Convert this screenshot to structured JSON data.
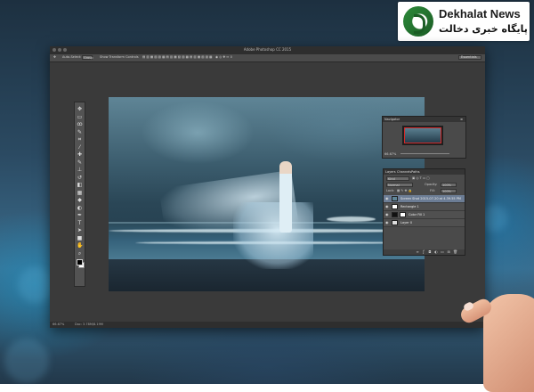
{
  "watermark": {
    "title": "Dekhalat News",
    "subtitle": "پایگاه خبری دخالت"
  },
  "app": {
    "window_title": "Adobe Photoshop CC 2015"
  },
  "options_bar": {
    "auto_select_label": "Auto-Select:",
    "auto_select_value": "Group",
    "transform_controls_label": "Show Transform Controls",
    "workspace_value": "Essentials"
  },
  "tools": [
    {
      "name": "move-tool",
      "icon": "move-icon",
      "glyph": "✥"
    },
    {
      "name": "marquee-tool",
      "icon": "marquee-icon",
      "glyph": "▭"
    },
    {
      "name": "lasso-tool",
      "icon": "lasso-icon",
      "glyph": "ꝏ"
    },
    {
      "name": "quick-select-tool",
      "icon": "quick-select-icon",
      "glyph": "✎"
    },
    {
      "name": "crop-tool",
      "icon": "crop-icon",
      "glyph": "⌗"
    },
    {
      "name": "eyedropper-tool",
      "icon": "eyedropper-icon",
      "glyph": "⁄"
    },
    {
      "name": "healing-tool",
      "icon": "bandage-icon",
      "glyph": "✚"
    },
    {
      "name": "brush-tool",
      "icon": "brush-icon",
      "glyph": "✎"
    },
    {
      "name": "clone-stamp-tool",
      "icon": "stamp-icon",
      "glyph": "⊥"
    },
    {
      "name": "history-brush-tool",
      "icon": "history-brush-icon",
      "glyph": "↺"
    },
    {
      "name": "eraser-tool",
      "icon": "eraser-icon",
      "glyph": "◧"
    },
    {
      "name": "gradient-tool",
      "icon": "gradient-icon",
      "glyph": "▦"
    },
    {
      "name": "blur-tool",
      "icon": "blur-icon",
      "glyph": "◆"
    },
    {
      "name": "dodge-tool",
      "icon": "dodge-icon",
      "glyph": "◐"
    },
    {
      "name": "pen-tool",
      "icon": "pen-icon",
      "glyph": "✒"
    },
    {
      "name": "type-tool",
      "icon": "type-icon",
      "glyph": "T"
    },
    {
      "name": "path-select-tool",
      "icon": "arrow-icon",
      "glyph": "➤"
    },
    {
      "name": "shape-tool",
      "icon": "rectangle-icon",
      "glyph": "■"
    },
    {
      "name": "hand-tool",
      "icon": "hand-icon",
      "glyph": "✋"
    },
    {
      "name": "zoom-tool",
      "icon": "zoom-icon",
      "glyph": "⌕"
    }
  ],
  "navigator": {
    "tab_label": "Navigator",
    "zoom_value": "66.67%"
  },
  "layers": {
    "tabs": [
      "Layers",
      "Channels",
      "Paths"
    ],
    "kind_label": "Kind",
    "blend_mode": "Normal",
    "opacity_label": "Opacity:",
    "opacity_value": "100%",
    "lock_label": "Lock:",
    "fill_label": "Fill:",
    "fill_value": "100%",
    "items": [
      {
        "name": "Screen Shot 2015-07-20 at 4.39.55 PM",
        "selected": true,
        "thumb_color": "#5f8596",
        "has_mask": false
      },
      {
        "name": "Rectangle 1",
        "selected": false,
        "thumb_color": "#ffffff",
        "has_mask": false
      },
      {
        "name": "Color Fill 1",
        "selected": false,
        "thumb_color": "#111111",
        "has_mask": true
      },
      {
        "name": "Layer 0",
        "selected": false,
        "thumb_color": "#dddddd",
        "has_mask": false
      }
    ]
  },
  "status": {
    "zoom": "66.67%",
    "doc_size": "Doc: 3.78M/8.19M"
  }
}
